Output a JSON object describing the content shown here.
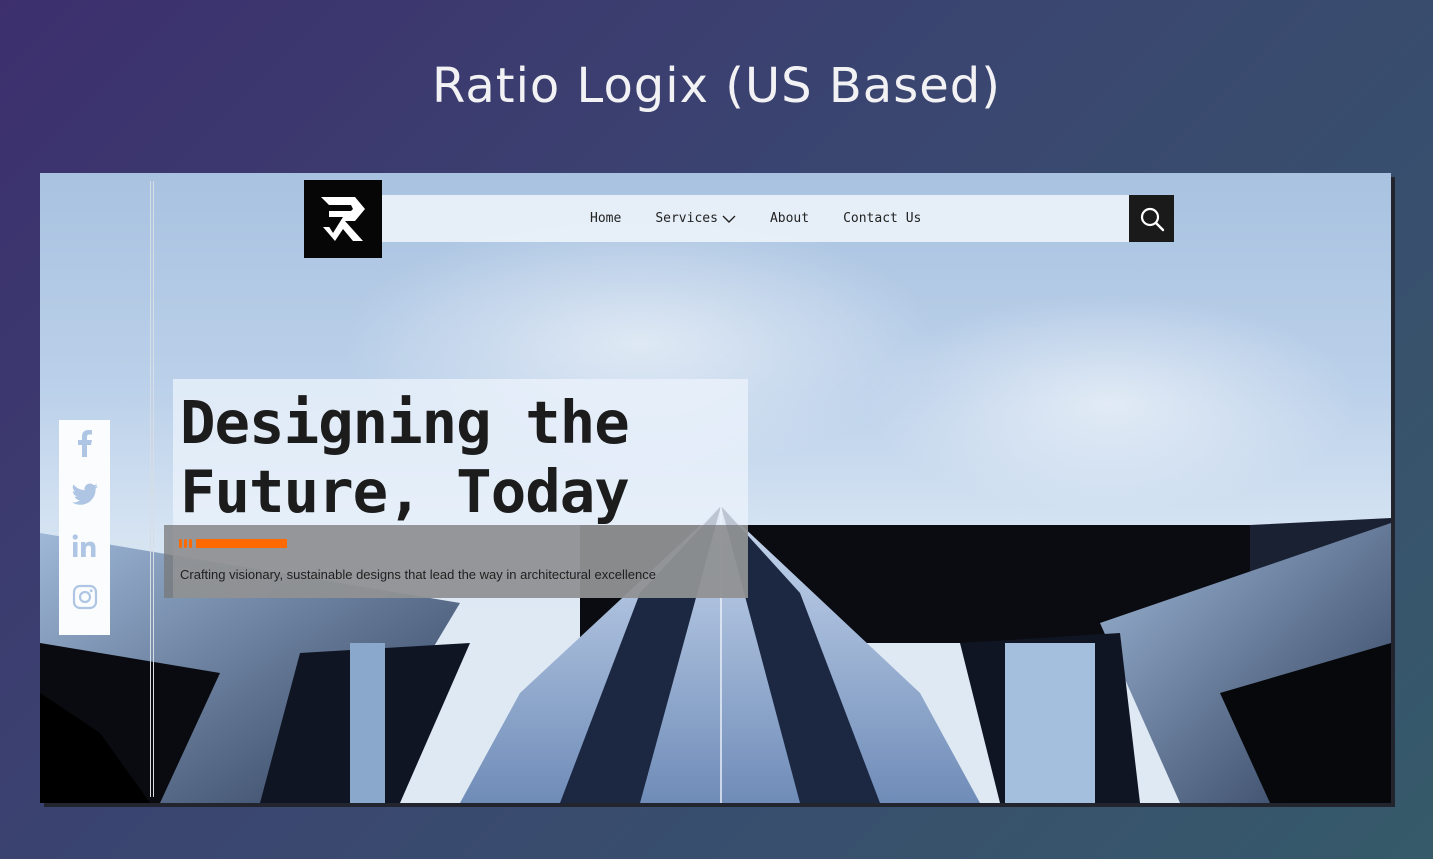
{
  "page": {
    "title": "Ratio Logix (US Based)"
  },
  "brand": {
    "logo_icon": "rl-monogram-logo",
    "colors": {
      "accent": "#ff6a00",
      "dark": "#060606"
    }
  },
  "nav": {
    "items": [
      {
        "label": "Home"
      },
      {
        "label": "Services",
        "has_dropdown": true
      },
      {
        "label": "About"
      },
      {
        "label": "Contact Us"
      }
    ],
    "search_icon": "search-icon"
  },
  "social": {
    "icons": [
      "facebook-icon",
      "twitter-icon",
      "linkedin-icon",
      "instagram-icon"
    ]
  },
  "hero": {
    "title_line1": "Designing the",
    "title_line2": "Future, Today",
    "subtitle": "Crafting visionary, sustainable designs that lead the way in architectural excellence"
  }
}
